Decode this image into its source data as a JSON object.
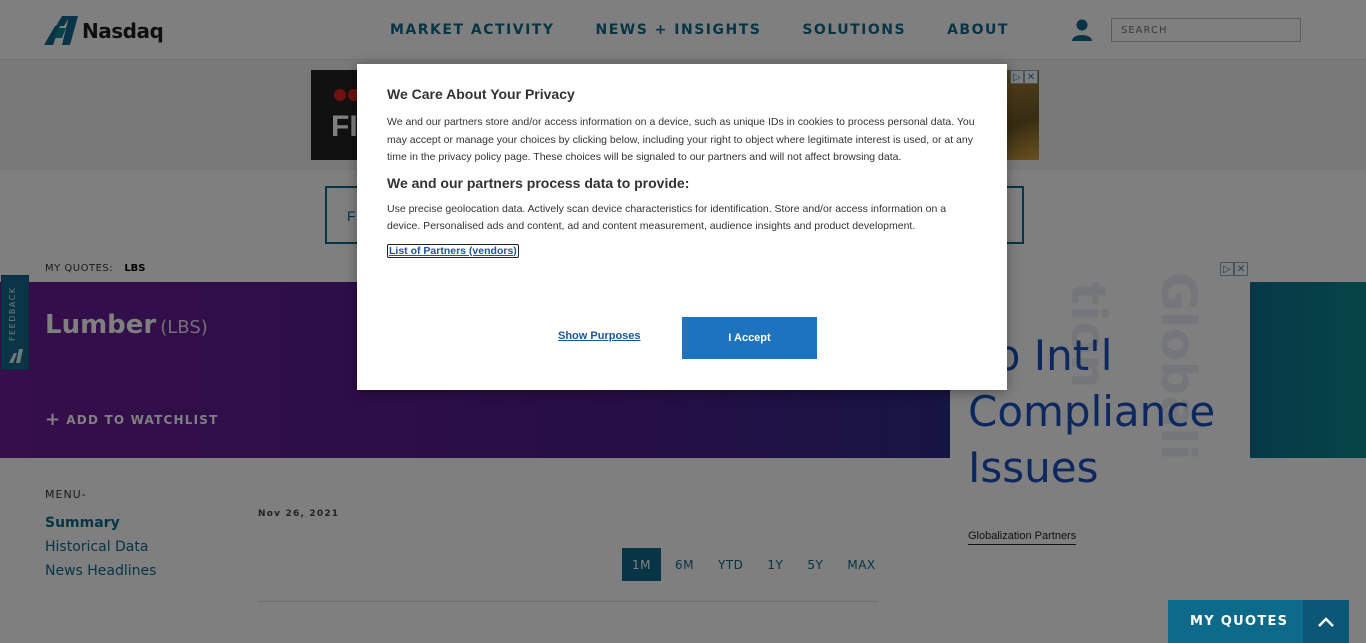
{
  "header": {
    "logo_text": "Nasdaq",
    "nav": [
      "MARKET ACTIVITY",
      "NEWS + INSIGHTS",
      "SOLUTIONS",
      "ABOUT"
    ],
    "search_placeholder": "SEARCH"
  },
  "ad_top": {
    "text": "FI"
  },
  "cta": {
    "letter": "F"
  },
  "my_quotes": {
    "label": "MY QUOTES:",
    "symbol": "LBS"
  },
  "hero": {
    "title": "Lumber",
    "symbol": "(LBS)",
    "watchlist_label": "ADD TO WATCHLIST"
  },
  "feedback": {
    "label": "FEEDBACK"
  },
  "menu": {
    "label": "MENU-",
    "items": [
      "Summary",
      "Historical Data",
      "News Headlines"
    ]
  },
  "chart_section": {
    "date": "Nov 26, 2021",
    "ranges": [
      "1M",
      "6M",
      "YTD",
      "1Y",
      "5Y",
      "MAX"
    ],
    "active_range": "1M"
  },
  "ad_right": {
    "headline_lines": [
      "op Int'l",
      "Compliance",
      "Issues"
    ],
    "brand": "Globalization Partners",
    "bg_text": "Globalization"
  },
  "bottom_bar": {
    "label": "MY QUOTES"
  },
  "modal": {
    "title": "We Care About Your Privacy",
    "body": "We and our partners store and/or access information on a device, such as unique IDs in cookies to process personal data. You may accept or manage your choices by clicking below, including your right to object where legitimate interest is used, or at any time in the privacy policy page. These choices will be signaled to our partners and will not affect browsing data.",
    "subtitle": "We and our partners process data to provide:",
    "purposes": "Use precise geolocation data. Actively scan device characteristics for identification. Store and/or access information on a device. Personalised ads and content, ad and content measurement, audience insights and product development.",
    "partners_link": "List of Partners (vendors)",
    "show_purposes": "Show Purposes",
    "accept": "I Accept"
  },
  "colors": {
    "brand": "#0e6a8a",
    "accept_button": "#1e73be",
    "link": "#1b55a3"
  }
}
